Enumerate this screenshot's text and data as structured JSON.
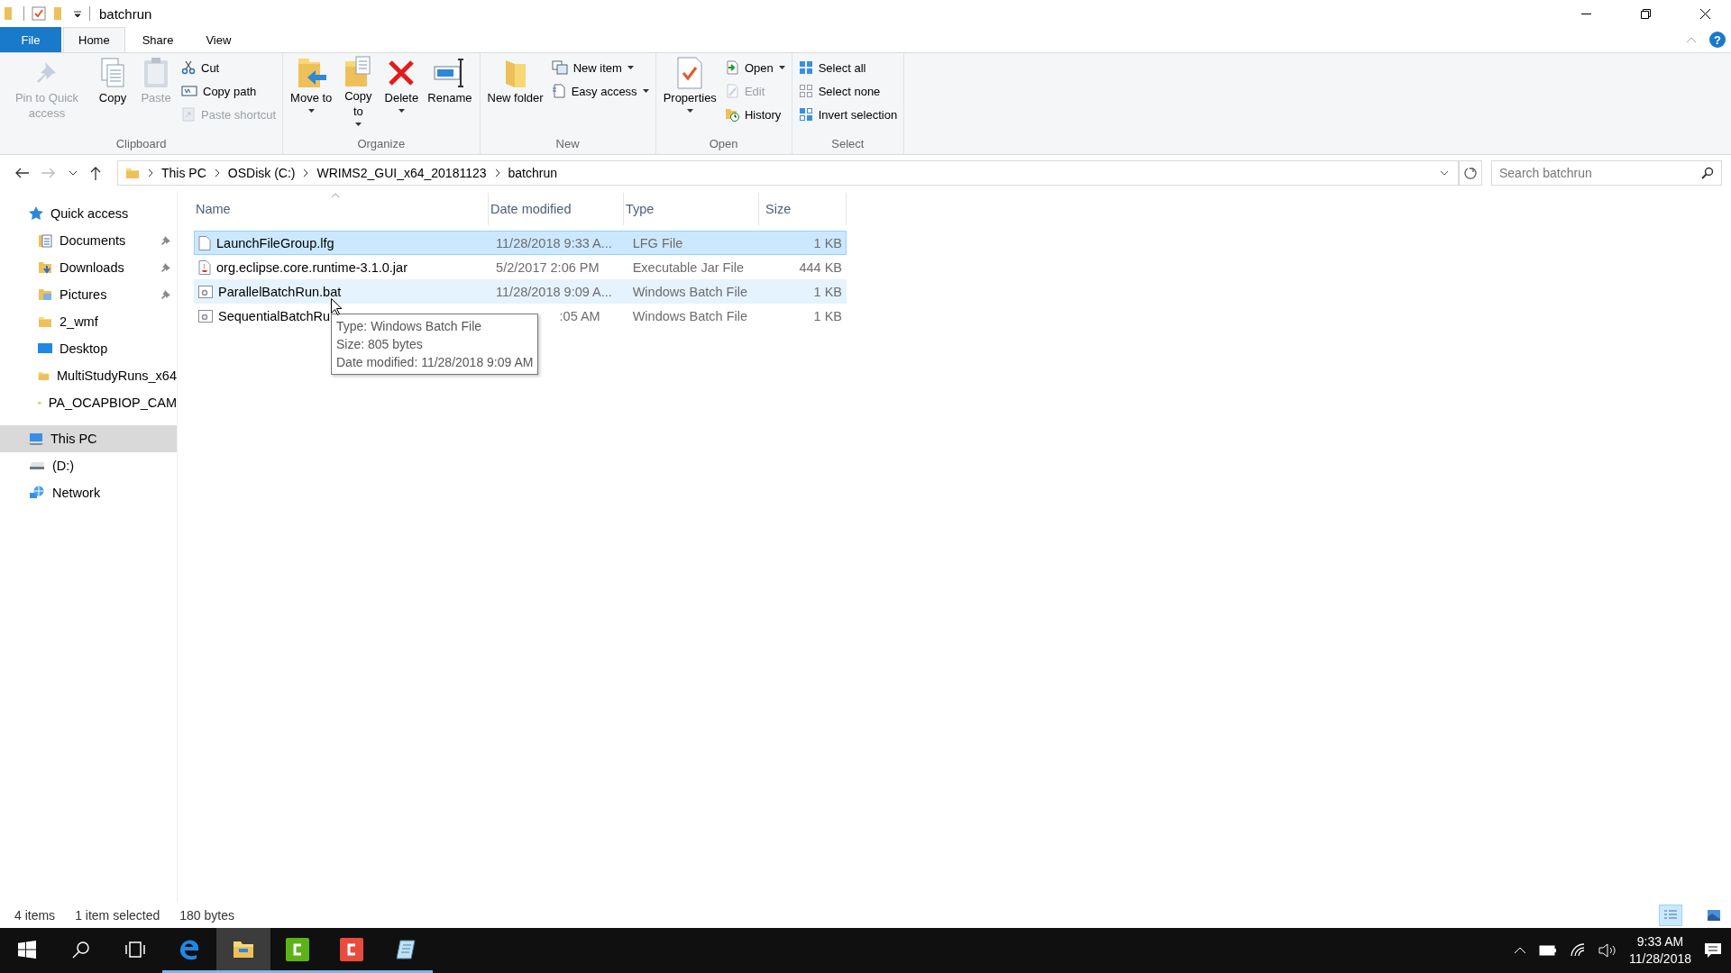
{
  "window": {
    "title": "batchrun"
  },
  "ribbon": {
    "tabs": [
      {
        "label": "File",
        "kind": "file",
        "selected": false
      },
      {
        "label": "Home",
        "kind": "tab",
        "selected": true
      },
      {
        "label": "Share",
        "kind": "tab",
        "selected": false
      },
      {
        "label": "View",
        "kind": "tab",
        "selected": false
      }
    ],
    "help": "?",
    "groups": [
      {
        "label": "Clipboard",
        "large": [
          {
            "label": "Pin to Quick access",
            "disabled": true,
            "dropdown": false
          },
          {
            "label": "Copy",
            "disabled": false,
            "dropdown": false
          },
          {
            "label": "Paste",
            "disabled": true,
            "dropdown": false
          }
        ],
        "small": [
          {
            "label": "Cut",
            "disabled": false,
            "dropdown": false
          },
          {
            "label": "Copy path",
            "disabled": false,
            "dropdown": false
          },
          {
            "label": "Paste shortcut",
            "disabled": true,
            "dropdown": false
          }
        ]
      },
      {
        "label": "Organize",
        "large": [
          {
            "label": "Move to",
            "disabled": false,
            "dropdown": true
          },
          {
            "label": "Copy to",
            "disabled": false,
            "dropdown": true
          },
          {
            "label": "Delete",
            "disabled": false,
            "dropdown": true
          },
          {
            "label": "Rename",
            "disabled": false,
            "dropdown": false
          }
        ]
      },
      {
        "label": "New",
        "large": [
          {
            "label": "New folder",
            "disabled": false,
            "dropdown": false
          }
        ],
        "small": [
          {
            "label": "New item",
            "disabled": false,
            "dropdown": true
          },
          {
            "label": "Easy access",
            "disabled": false,
            "dropdown": true
          }
        ]
      },
      {
        "label": "Open",
        "large": [
          {
            "label": "Properties",
            "disabled": false,
            "dropdown": true
          }
        ],
        "small": [
          {
            "label": "Open",
            "disabled": false,
            "dropdown": true
          },
          {
            "label": "Edit",
            "disabled": true,
            "dropdown": false
          },
          {
            "label": "History",
            "disabled": false,
            "dropdown": false
          }
        ]
      },
      {
        "label": "Select",
        "small": [
          {
            "label": "Select all",
            "disabled": false,
            "dropdown": false
          },
          {
            "label": "Select none",
            "disabled": false,
            "dropdown": false
          },
          {
            "label": "Invert selection",
            "disabled": false,
            "dropdown": false
          }
        ]
      }
    ]
  },
  "address": {
    "crumbs": [
      "This PC",
      "OSDisk (C:)",
      "WRIMS2_GUI_x64_20181123",
      "batchrun"
    ],
    "search_placeholder": "Search batchrun"
  },
  "sidebar": {
    "items": [
      {
        "label": "Quick access",
        "kind": "quick",
        "selected": false,
        "children": [
          {
            "label": "Documents",
            "kind": "docs",
            "pinned": true,
            "selected": false
          },
          {
            "label": "Downloads",
            "kind": "downloads",
            "pinned": true,
            "selected": false
          },
          {
            "label": "Pictures",
            "kind": "pictures",
            "pinned": true,
            "selected": false
          },
          {
            "label": "2_wmf",
            "kind": "folder",
            "pinned": false,
            "selected": false
          },
          {
            "label": "Desktop",
            "kind": "desktop",
            "pinned": false,
            "selected": false
          },
          {
            "label": "MultiStudyRuns_x64",
            "kind": "folder",
            "pinned": false,
            "selected": false
          },
          {
            "label": "PA_OCAPBIOP_CAM",
            "kind": "folder",
            "pinned": false,
            "selected": false
          }
        ]
      },
      {
        "label": "This PC",
        "kind": "pc",
        "selected": true
      },
      {
        "label": "(D:)",
        "kind": "drive",
        "selected": false
      },
      {
        "label": "Network",
        "kind": "network",
        "selected": false
      }
    ]
  },
  "table": {
    "columns": [
      "Name",
      "Date modified",
      "Type",
      "Size"
    ],
    "rows": [
      {
        "kind": "file",
        "name": "LaunchFileGroup.lfg",
        "date": "11/28/2018 9:33 A...",
        "type": "LFG File",
        "size": "1 KB",
        "selected": true,
        "hovered": false
      },
      {
        "kind": "jar",
        "name": "org.eclipse.core.runtime-3.1.0.jar",
        "date": "5/2/2017 2:06 PM",
        "type": "Executable Jar File",
        "size": "444 KB",
        "selected": false,
        "hovered": false
      },
      {
        "kind": "batch",
        "name": "ParallelBatchRun.bat",
        "date": "11/28/2018 9:09 A...",
        "type": "Windows Batch File",
        "size": "1 KB",
        "selected": false,
        "hovered": true
      },
      {
        "kind": "batch_covered",
        "name": "SequentialBatchRu",
        "date": ":05 AM",
        "type": "Windows Batch File",
        "size": "1 KB",
        "selected": false,
        "hovered": false
      }
    ]
  },
  "tooltip": [
    "Type: Windows Batch File",
    "Size: 805 bytes",
    "Date modified: 11/28/2018 9:09 AM"
  ],
  "status_bar": {
    "count": "4 items",
    "selection": "1 item selected",
    "size": "180 bytes",
    "views": [
      {
        "kind": "details",
        "selected": true
      },
      {
        "kind": "large",
        "selected": false
      }
    ]
  },
  "taskbar": {
    "apps": [
      {
        "kind": "edge",
        "active": false,
        "running": true
      },
      {
        "kind": "explorer",
        "active": true,
        "running": true
      },
      {
        "kind": "green",
        "active": false,
        "running": true
      },
      {
        "kind": "red",
        "active": false,
        "running": true
      },
      {
        "kind": "notes",
        "active": false,
        "running": true
      }
    ],
    "time": "9:33 AM",
    "date": "11/28/2018"
  }
}
